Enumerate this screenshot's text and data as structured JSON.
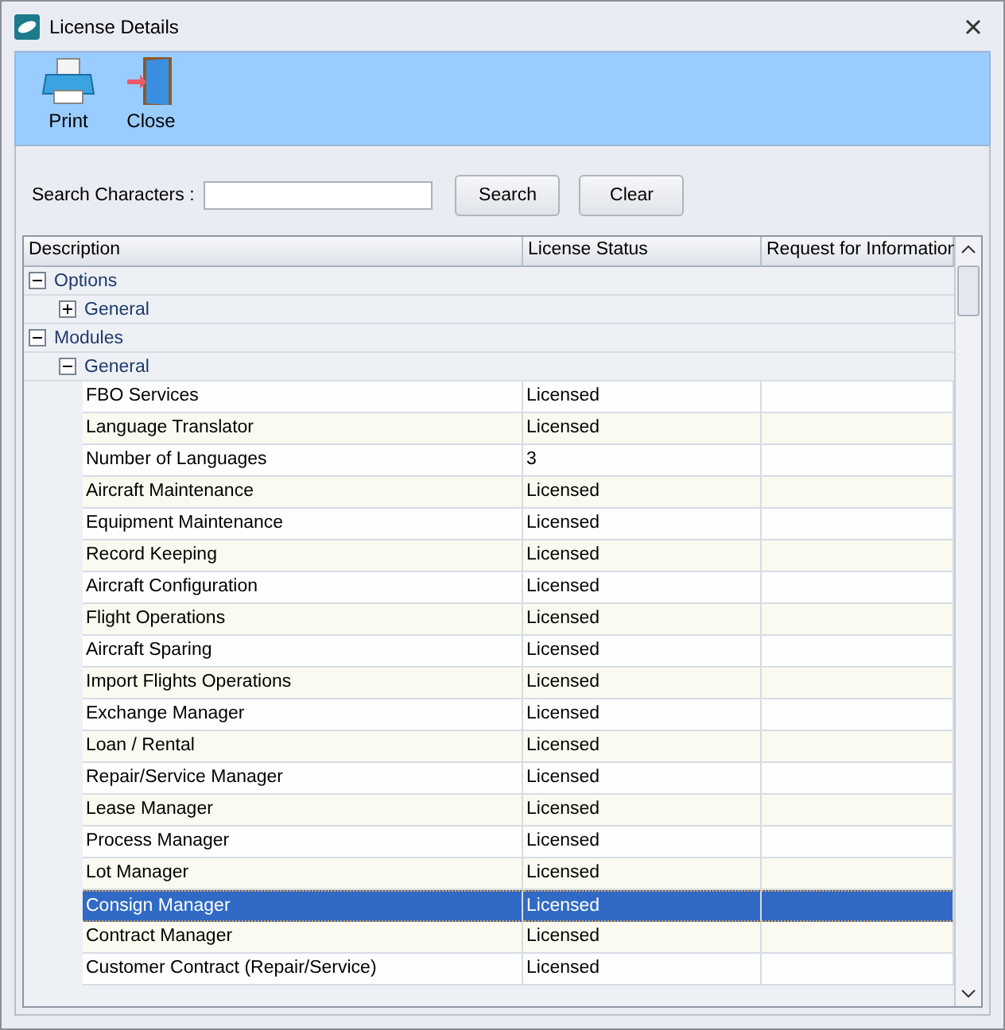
{
  "window": {
    "title": "License Details"
  },
  "toolbar": [
    {
      "label": "Print",
      "kind": "print"
    },
    {
      "label": "Close",
      "kind": "close"
    }
  ],
  "search": {
    "label": "Search Characters :",
    "buttons": [
      "Search",
      "Clear"
    ]
  },
  "table": {
    "columns": [
      "Description",
      "License Status",
      "Request for Information"
    ],
    "rows": [
      {
        "label": "Options",
        "expanded": true,
        "children": [
          {
            "label": "General",
            "expanded": false
          }
        ]
      },
      {
        "label": "Modules",
        "expanded": true,
        "children": [
          {
            "label": "General",
            "expanded": true,
            "children": [
              {
                "description": "FBO Services",
                "status": "Licensed",
                "selected": false
              },
              {
                "description": "Language Translator",
                "status": "Licensed",
                "selected": false
              },
              {
                "description": "Number of Languages",
                "status": "3",
                "selected": false
              },
              {
                "description": "Aircraft Maintenance",
                "status": "Licensed",
                "selected": false
              },
              {
                "description": "Equipment Maintenance",
                "status": "Licensed",
                "selected": false
              },
              {
                "description": "Record Keeping",
                "status": "Licensed",
                "selected": false
              },
              {
                "description": "Aircraft Configuration",
                "status": "Licensed",
                "selected": false
              },
              {
                "description": "Flight Operations",
                "status": "Licensed",
                "selected": false
              },
              {
                "description": "Aircraft Sparing",
                "status": "Licensed",
                "selected": false
              },
              {
                "description": "Import Flights Operations",
                "status": "Licensed",
                "selected": false
              },
              {
                "description": "Exchange Manager",
                "status": "Licensed",
                "selected": false
              },
              {
                "description": "Loan / Rental",
                "status": "Licensed",
                "selected": false
              },
              {
                "description": "Repair/Service Manager",
                "status": "Licensed",
                "selected": false
              },
              {
                "description": "Lease Manager",
                "status": "Licensed",
                "selected": false
              },
              {
                "description": "Process Manager",
                "status": "Licensed",
                "selected": false
              },
              {
                "description": "Lot Manager",
                "status": "Licensed",
                "selected": false
              },
              {
                "description": "Consign Manager",
                "status": "Licensed",
                "selected": true
              },
              {
                "description": "Contract Manager",
                "status": "Licensed",
                "selected": false
              },
              {
                "description": "Customer Contract (Repair/Service)",
                "status": "Licensed",
                "selected": false
              }
            ]
          }
        ]
      }
    ]
  }
}
